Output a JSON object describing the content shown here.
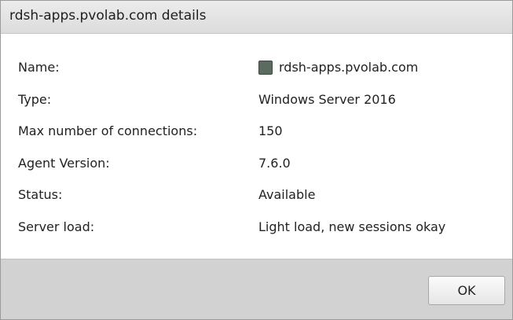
{
  "dialog": {
    "title": "rdsh-apps.pvolab.com details",
    "ok_label": "OK"
  },
  "details": [
    {
      "label": "Name:",
      "value": "rdsh-apps.pvolab.com",
      "icon": "server-icon"
    },
    {
      "label": "Type:",
      "value": "Windows Server 2016"
    },
    {
      "label": "Max number of connections:",
      "value": "150"
    },
    {
      "label": "Agent Version:",
      "value": "7.6.0"
    },
    {
      "label": "Status:",
      "value": "Available"
    },
    {
      "label": "Server load:",
      "value": "Light load, new sessions okay"
    }
  ],
  "colors": {
    "titlebar": "#e3e3e3",
    "footer": "#d2d2d2",
    "icon": "#5c6b5f"
  }
}
